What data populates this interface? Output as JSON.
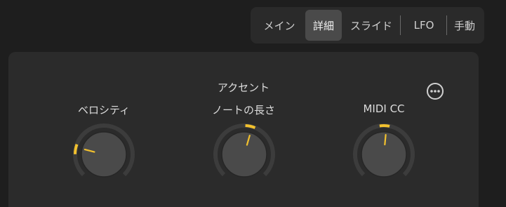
{
  "tabs": [
    {
      "label": "メイン",
      "selected": false
    },
    {
      "label": "詳細",
      "selected": true
    },
    {
      "label": "スライド",
      "selected": false
    },
    {
      "label": "LFO",
      "selected": false
    },
    {
      "label": "手動",
      "selected": false
    }
  ],
  "group_label": "アクセント",
  "more_icon": "ellipsis-circle-icon",
  "knobs": [
    {
      "label": "ベロシティ",
      "value": 0.22
    },
    {
      "label": "ノートの長さ",
      "value": 0.56
    },
    {
      "label": "MIDI CC",
      "value": 0.52
    }
  ],
  "colors": {
    "accent": "#f2c12e",
    "track": "#3c3c3c",
    "knob_body": "#4a4a4a",
    "panel": "#2b2b2b",
    "background": "#1e1e1e"
  }
}
